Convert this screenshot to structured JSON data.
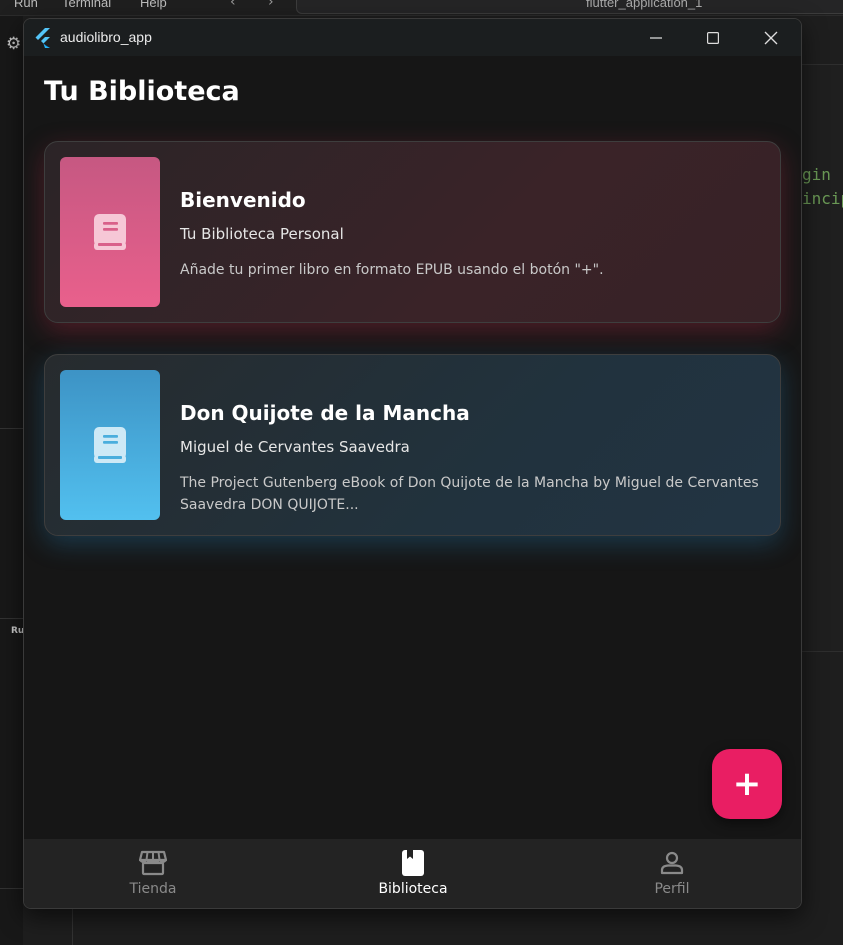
{
  "ide": {
    "menu": [
      "Run",
      "Terminal",
      "Help"
    ],
    "search_text": "flutter_application_1",
    "panel_label": "Ru",
    "code_lines": [
      "gin",
      "incip"
    ]
  },
  "window": {
    "title": "audiolibro_app",
    "controls": [
      "minimize",
      "maximize",
      "close"
    ]
  },
  "page": {
    "title": "Tu Biblioteca"
  },
  "books": [
    {
      "title": "Bienvenido",
      "author": "Tu Biblioteca Personal",
      "description": "Añade tu primer libro en formato EPUB usando el botón \"+\".",
      "icon": "book-icon",
      "accent": "#e9608c"
    },
    {
      "title": "Don Quijote de la Mancha",
      "author": "Miguel de Cervantes Saavedra",
      "description": " The Project Gutenberg eBook of Don Quijote de la Mancha by Miguel de Cervantes Saavedra DON QUIJOTE...",
      "icon": "book-icon",
      "accent": "#52c0ef"
    }
  ],
  "fab": {
    "label": "+",
    "color": "#e91e63"
  },
  "bottom_nav": {
    "items": [
      {
        "label": "Tienda",
        "icon": "store-icon",
        "active": false
      },
      {
        "label": "Biblioteca",
        "icon": "bookmark-book-icon",
        "active": true
      },
      {
        "label": "Perfil",
        "icon": "person-icon",
        "active": false
      }
    ]
  }
}
